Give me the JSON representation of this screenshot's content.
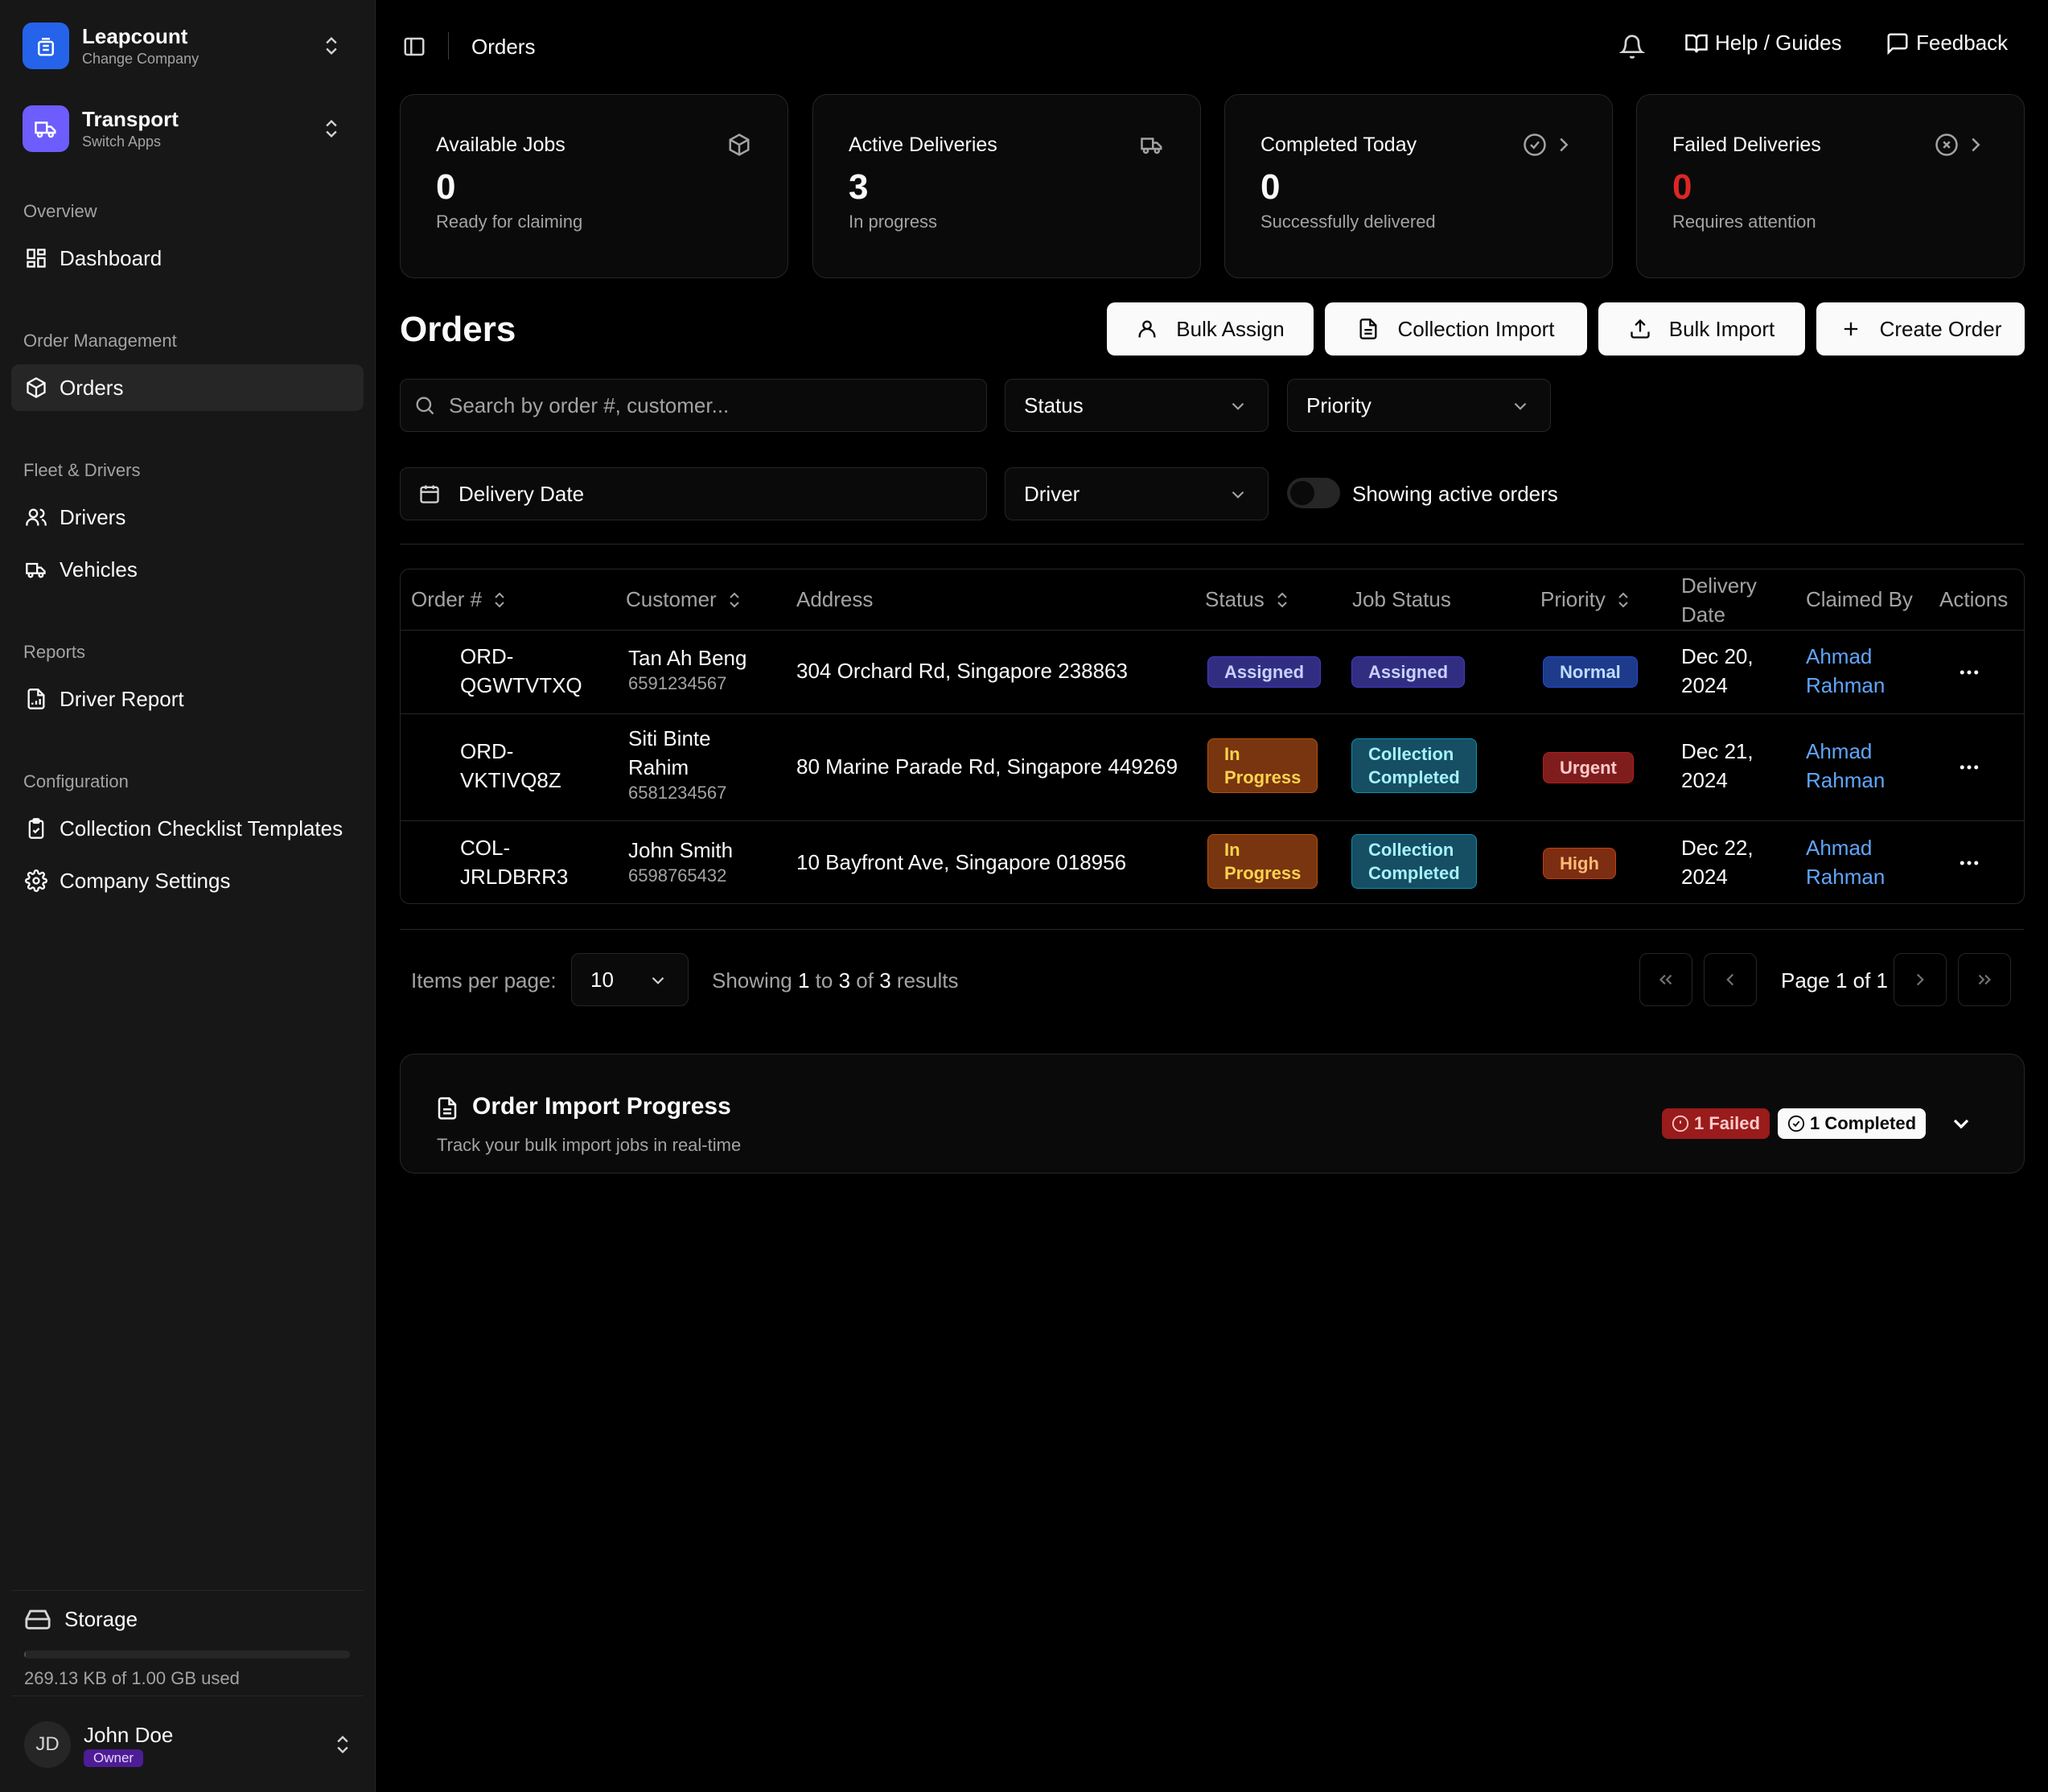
{
  "sidebar": {
    "company": {
      "name": "Leapcount",
      "sub": "Change Company"
    },
    "app": {
      "name": "Transport",
      "sub": "Switch Apps"
    },
    "groups": {
      "overview": "Overview",
      "order_management": "Order Management",
      "fleet": "Fleet & Drivers",
      "reports": "Reports",
      "configuration": "Configuration"
    },
    "items": {
      "dashboard": "Dashboard",
      "orders": "Orders",
      "drivers": "Drivers",
      "vehicles": "Vehicles",
      "driver_report": "Driver Report",
      "checklist": "Collection Checklist Templates",
      "settings": "Company Settings"
    },
    "storage": {
      "label": "Storage",
      "used_text": "269.13 KB of 1.00 GB used",
      "used_fraction": 0.0003
    },
    "user": {
      "initials": "JD",
      "name": "John Doe",
      "role": "Owner"
    }
  },
  "topbar": {
    "breadcrumb": "Orders",
    "help": "Help / Guides",
    "feedback": "Feedback"
  },
  "stats": [
    {
      "label": "Available Jobs",
      "value": "0",
      "sub": "Ready for claiming"
    },
    {
      "label": "Active Deliveries",
      "value": "3",
      "sub": "In progress"
    },
    {
      "label": "Completed Today",
      "value": "0",
      "sub": "Successfully delivered"
    },
    {
      "label": "Failed Deliveries",
      "value": "0",
      "sub": "Requires attention"
    }
  ],
  "orders": {
    "title": "Orders",
    "buttons": {
      "bulk_assign": "Bulk Assign",
      "collection_import": "Collection Import",
      "bulk_import": "Bulk Import",
      "create_order": "Create Order"
    },
    "filters": {
      "search_placeholder": "Search by order #, customer...",
      "status": "Status",
      "priority": "Priority",
      "delivery_date": "Delivery Date",
      "driver": "Driver",
      "toggle_label": "Showing active orders"
    },
    "columns": {
      "order": "Order #",
      "customer": "Customer",
      "address": "Address",
      "status": "Status",
      "job_status": "Job Status",
      "priority": "Priority",
      "delivery_date_1": "Delivery",
      "delivery_date_2": "Date",
      "claimed_by": "Claimed By",
      "actions": "Actions"
    },
    "rows": [
      {
        "order_1": "ORD-",
        "order_2": "QGWTVTXQ",
        "customer_1": "Tan Ah Beng",
        "customer_2": "",
        "phone": "6591234567",
        "address": "304 Orchard Rd, Singapore 238863",
        "status_1": "Assigned",
        "status_2": "",
        "job_1": "Assigned",
        "job_2": "",
        "priority": "Normal",
        "date_1": "Dec 20,",
        "date_2": "2024",
        "claimed_1": "Ahmad",
        "claimed_2": "Rahman"
      },
      {
        "order_1": "ORD-",
        "order_2": "VKTIVQ8Z",
        "customer_1": "Siti Binte",
        "customer_2": "Rahim",
        "phone": "6581234567",
        "address": "80 Marine Parade Rd, Singapore 449269",
        "status_1": "In",
        "status_2": "Progress",
        "job_1": "Collection",
        "job_2": "Completed",
        "priority": "Urgent",
        "date_1": "Dec 21,",
        "date_2": "2024",
        "claimed_1": "Ahmad",
        "claimed_2": "Rahman"
      },
      {
        "order_1": "COL-",
        "order_2": "JRLDBRR3",
        "customer_1": "John Smith",
        "customer_2": "",
        "phone": "6598765432",
        "address": "10 Bayfront Ave, Singapore 018956",
        "status_1": "In",
        "status_2": "Progress",
        "job_1": "Collection",
        "job_2": "Completed",
        "priority": "High",
        "date_1": "Dec 22,",
        "date_2": "2024",
        "claimed_1": "Ahmad",
        "claimed_2": "Rahman"
      }
    ],
    "pagination": {
      "items_per_page_label": "Items per page:",
      "per_page": "10",
      "showing": "Showing",
      "from": "1",
      "to_word": "to",
      "to": "3",
      "of_word": "of",
      "total": "3",
      "results": "results",
      "page_text": "Page 1 of 1"
    }
  },
  "import_progress": {
    "title": "Order Import Progress",
    "desc": "Track your bulk import jobs in real-time",
    "failed": "1 Failed",
    "completed": "1 Completed"
  },
  "colors": {
    "accent_blue": "#2563eb",
    "app_purple": "#6d5dfc",
    "failed_red": "#dc2626"
  }
}
